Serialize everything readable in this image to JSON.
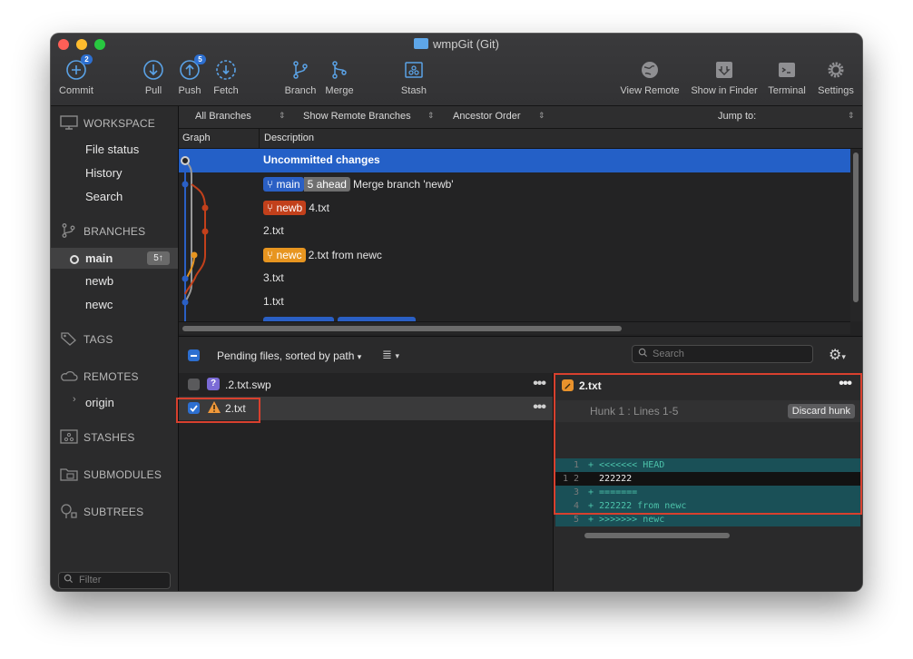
{
  "window": {
    "title": "wmpGit (Git)"
  },
  "toolbar": {
    "commit": {
      "label": "Commit",
      "badge": "2"
    },
    "pull": {
      "label": "Pull"
    },
    "push": {
      "label": "Push",
      "badge": "5"
    },
    "fetch": {
      "label": "Fetch"
    },
    "branch": {
      "label": "Branch"
    },
    "merge": {
      "label": "Merge"
    },
    "stash": {
      "label": "Stash"
    },
    "view_remote": {
      "label": "View Remote"
    },
    "show_in_finder": {
      "label": "Show in Finder"
    },
    "terminal": {
      "label": "Terminal"
    },
    "settings": {
      "label": "Settings"
    }
  },
  "sidebar": {
    "workspace": {
      "heading": "WORKSPACE",
      "items": [
        "File status",
        "History",
        "Search"
      ]
    },
    "branches": {
      "heading": "BRANCHES",
      "items": [
        "main",
        "newb",
        "newc"
      ],
      "current_badge": "5↑"
    },
    "tags": {
      "heading": "TAGS"
    },
    "remotes": {
      "heading": "REMOTES",
      "items": [
        "origin"
      ]
    },
    "stashes": {
      "heading": "STASHES"
    },
    "submodules": {
      "heading": "SUBMODULES"
    },
    "subtrees": {
      "heading": "SUBTREES"
    },
    "filter_placeholder": "Filter"
  },
  "graph_bar": {
    "branches_filter": "All Branches",
    "remote_filter": "Show Remote Branches",
    "order": "Ancestor Order",
    "jump_to": "Jump to:"
  },
  "graph_columns": {
    "graph": "Graph",
    "description": "Description"
  },
  "commits": [
    {
      "description": "Uncommitted changes"
    },
    {
      "branch": "main",
      "ahead": "5 ahead",
      "description": "Merge branch 'newb'"
    },
    {
      "branch": "newb",
      "description": "4.txt"
    },
    {
      "description": "2.txt"
    },
    {
      "branch": "newc",
      "description": "2.txt from newc"
    },
    {
      "description": "3.txt"
    },
    {
      "description": "1.txt"
    }
  ],
  "pending": {
    "label": "Pending files, sorted by path",
    "search_placeholder": "Search",
    "files": [
      {
        "name": ".2.txt.swp",
        "checked": false,
        "status": "?"
      },
      {
        "name": "2.txt",
        "checked": true,
        "status": "!"
      }
    ]
  },
  "diff": {
    "file": "2.txt",
    "hunk_title": "Hunk 1 : Lines 1-5",
    "discard_label": "Discard hunk",
    "lines": [
      {
        "old": "",
        "new": "1",
        "type": "add",
        "text": "+ <<<<<<< HEAD"
      },
      {
        "old": "1",
        "new": "2",
        "type": "ctx",
        "text": "  222222"
      },
      {
        "old": "",
        "new": "3",
        "type": "add",
        "text": "+ ======="
      },
      {
        "old": "",
        "new": "4",
        "type": "add",
        "text": "+ 222222 from newc"
      },
      {
        "old": "",
        "new": "5",
        "type": "add",
        "text": "+ >>>>>>> newc"
      }
    ]
  },
  "colors": {
    "accent": "#2460c7",
    "branch_main": "#2a5fc4",
    "branch_newb": "#c2401b",
    "branch_newc": "#e79520",
    "highlight_box": "#d8402e"
  }
}
